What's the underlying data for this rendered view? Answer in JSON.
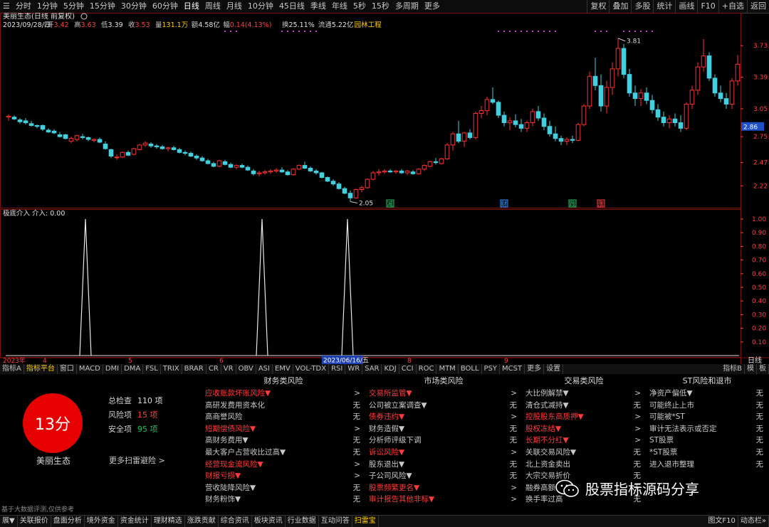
{
  "topbar": {
    "periods": [
      "分时",
      "1分钟",
      "5分钟",
      "15分钟",
      "30分钟",
      "60分钟",
      "日线",
      "周线",
      "月线",
      "10分钟",
      "45日线",
      "季线",
      "年线",
      "5秒",
      "15秒",
      "多周期",
      "更多"
    ],
    "active_period": "日线",
    "right_buttons": [
      "复权",
      "叠加",
      "多股",
      "统计",
      "画线",
      "F10",
      "+自选",
      "返回"
    ]
  },
  "chart_header": {
    "name": "美丽生态(日线 前复权)",
    "date": "2023/09/28/四",
    "items": [
      {
        "label": "开",
        "value": "3.42",
        "color": "#ff4040"
      },
      {
        "label": "高",
        "value": "3.63",
        "color": "#ff4040"
      },
      {
        "label": "低",
        "value": "3.39",
        "color": "#e0e0e0"
      },
      {
        "label": "收",
        "value": "3.53",
        "color": "#ff4040"
      },
      {
        "label": "量",
        "value": "131.1万",
        "color": "#ffcc00"
      },
      {
        "label": "额",
        "value": "4.58亿",
        "color": "#e0e0e0"
      },
      {
        "label": "幅",
        "value": "0.14(4.13%)",
        "color": "#ff4040"
      },
      {
        "label": "换",
        "value": "25.11%",
        "color": "#e0e0e0"
      },
      {
        "label": "流通",
        "value": "5.22亿",
        "color": "#e0e0e0"
      },
      {
        "label": "",
        "value": "园林工程",
        "color": "#ffcc00"
      }
    ]
  },
  "price_axis": [
    "3.73",
    "3.39",
    "3.05",
    "2.75",
    "2.47",
    "2.22"
  ],
  "current_price": "2.86",
  "high_annotation": "3.81",
  "low_annotation": "2.05",
  "events": [
    {
      "label": "减",
      "index": 67,
      "color": "#20c060"
    },
    {
      "label": "财",
      "index": 87,
      "color": "#3090ff"
    },
    {
      "label": "践",
      "index": 99,
      "color": "#20c060"
    },
    {
      "label": "涨",
      "index": 104,
      "color": "#ff4040"
    }
  ],
  "indicator": {
    "title": "极底介入  介入: 0.00",
    "axis": [
      "1.00",
      "0.90",
      "0.80",
      "0.70",
      "0.60",
      "0.50",
      "0.40",
      "0.30",
      "0.20",
      "0.10"
    ]
  },
  "date_axis": {
    "labels": [
      {
        "text": "2023年",
        "index": 0
      },
      {
        "text": "4",
        "index": 6
      },
      {
        "text": "5",
        "index": 21
      },
      {
        "text": "6",
        "index": 37
      },
      {
        "text": "8",
        "index": 70
      },
      {
        "text": "9",
        "index": 87
      }
    ],
    "cursor": "2023/06/16/五",
    "right_label": "日线"
  },
  "chart_data": {
    "type": "candlestick",
    "ohlc": [
      [
        2.96,
        2.99,
        2.92,
        2.97
      ],
      [
        2.96,
        2.98,
        2.93,
        2.94
      ],
      [
        2.93,
        2.95,
        2.89,
        2.91
      ],
      [
        2.92,
        2.95,
        2.88,
        2.9
      ],
      [
        2.89,
        2.92,
        2.86,
        2.87
      ],
      [
        2.87,
        2.88,
        2.84,
        2.86
      ],
      [
        2.87,
        2.88,
        2.81,
        2.83
      ],
      [
        2.82,
        2.84,
        2.79,
        2.8
      ],
      [
        2.81,
        2.83,
        2.78,
        2.79
      ],
      [
        2.77,
        2.8,
        2.74,
        2.75
      ],
      [
        2.77,
        2.78,
        2.72,
        2.73
      ],
      [
        2.7,
        2.75,
        2.68,
        2.73
      ],
      [
        2.72,
        2.77,
        2.7,
        2.76
      ],
      [
        2.75,
        2.78,
        2.72,
        2.74
      ],
      [
        2.74,
        2.75,
        2.7,
        2.72
      ],
      [
        2.71,
        2.73,
        2.69,
        2.72
      ],
      [
        2.72,
        2.74,
        2.68,
        2.69
      ],
      [
        2.67,
        2.7,
        2.61,
        2.62
      ],
      [
        2.61,
        2.62,
        2.52,
        2.54
      ],
      [
        2.53,
        2.56,
        2.5,
        2.53
      ],
      [
        2.53,
        2.59,
        2.52,
        2.58
      ],
      [
        2.58,
        2.6,
        2.54,
        2.55
      ],
      [
        2.56,
        2.63,
        2.55,
        2.62
      ],
      [
        2.61,
        2.67,
        2.6,
        2.66
      ],
      [
        2.66,
        2.7,
        2.64,
        2.68
      ],
      [
        2.67,
        2.69,
        2.63,
        2.65
      ],
      [
        2.65,
        2.67,
        2.62,
        2.64
      ],
      [
        2.64,
        2.66,
        2.61,
        2.62
      ],
      [
        2.62,
        2.64,
        2.59,
        2.63
      ],
      [
        2.63,
        2.65,
        2.6,
        2.61
      ],
      [
        2.61,
        2.63,
        2.57,
        2.58
      ],
      [
        2.58,
        2.6,
        2.55,
        2.57
      ],
      [
        2.57,
        2.59,
        2.53,
        2.54
      ],
      [
        2.54,
        2.56,
        2.5,
        2.52
      ],
      [
        2.52,
        2.54,
        2.48,
        2.49
      ],
      [
        2.49,
        2.51,
        2.45,
        2.46
      ],
      [
        2.46,
        2.48,
        2.42,
        2.43
      ],
      [
        2.43,
        2.5,
        2.42,
        2.49
      ],
      [
        2.48,
        2.5,
        2.44,
        2.45
      ],
      [
        2.45,
        2.47,
        2.41,
        2.42
      ],
      [
        2.42,
        2.45,
        2.4,
        2.44
      ],
      [
        2.44,
        2.46,
        2.41,
        2.42
      ],
      [
        2.42,
        2.44,
        2.38,
        2.39
      ],
      [
        2.38,
        2.4,
        2.33,
        2.35
      ],
      [
        2.35,
        2.38,
        2.32,
        2.36
      ],
      [
        2.36,
        2.39,
        2.34,
        2.37
      ],
      [
        2.37,
        2.4,
        2.35,
        2.38
      ],
      [
        2.38,
        2.41,
        2.36,
        2.39
      ],
      [
        2.39,
        2.42,
        2.36,
        2.37
      ],
      [
        2.37,
        2.39,
        2.33,
        2.34
      ],
      [
        2.34,
        2.41,
        2.33,
        2.4
      ],
      [
        2.4,
        2.45,
        2.39,
        2.44
      ],
      [
        2.44,
        2.48,
        2.4,
        2.41
      ],
      [
        2.41,
        2.43,
        2.37,
        2.38
      ],
      [
        2.38,
        2.4,
        2.34,
        2.36
      ],
      [
        2.36,
        2.37,
        2.3,
        2.31
      ],
      [
        2.31,
        2.32,
        2.26,
        2.27
      ],
      [
        2.27,
        2.29,
        2.22,
        2.24
      ],
      [
        2.24,
        2.26,
        2.18,
        2.19
      ],
      [
        2.19,
        2.21,
        2.13,
        2.14
      ],
      [
        2.14,
        2.17,
        2.05,
        2.09
      ],
      [
        2.09,
        2.19,
        2.08,
        2.18
      ],
      [
        2.18,
        2.22,
        2.15,
        2.2
      ],
      [
        2.2,
        2.3,
        2.19,
        2.29
      ],
      [
        2.29,
        2.38,
        2.28,
        2.36
      ],
      [
        2.36,
        2.4,
        2.33,
        2.37
      ],
      [
        2.37,
        2.4,
        2.35,
        2.38
      ],
      [
        2.38,
        2.4,
        2.36,
        2.37
      ],
      [
        2.37,
        2.39,
        2.35,
        2.38
      ],
      [
        2.38,
        2.4,
        2.35,
        2.36
      ],
      [
        2.36,
        2.39,
        2.34,
        2.38
      ],
      [
        2.37,
        2.39,
        2.34,
        2.35
      ],
      [
        2.35,
        2.41,
        2.34,
        2.4
      ],
      [
        2.4,
        2.45,
        2.38,
        2.44
      ],
      [
        2.43,
        2.49,
        2.42,
        2.48
      ],
      [
        2.48,
        2.52,
        2.45,
        2.47
      ],
      [
        2.46,
        2.52,
        2.45,
        2.51
      ],
      [
        2.51,
        2.68,
        2.5,
        2.66
      ],
      [
        2.66,
        2.8,
        2.6,
        2.78
      ],
      [
        2.78,
        2.92,
        2.68,
        2.7
      ],
      [
        2.7,
        2.8,
        2.64,
        2.79
      ],
      [
        2.79,
        2.83,
        2.72,
        2.74
      ],
      [
        2.74,
        3.02,
        2.72,
        3.0
      ],
      [
        3.0,
        3.08,
        2.95,
        3.03
      ],
      [
        3.03,
        3.18,
        2.98,
        3.15
      ],
      [
        3.15,
        3.28,
        3.1,
        3.12
      ],
      [
        3.12,
        3.14,
        2.95,
        2.98
      ],
      [
        2.98,
        3.02,
        2.86,
        2.9
      ],
      [
        2.9,
        2.96,
        2.82,
        2.92
      ],
      [
        2.92,
        2.99,
        2.85,
        2.88
      ],
      [
        2.88,
        2.94,
        2.8,
        2.84
      ],
      [
        2.84,
        2.92,
        2.8,
        2.9
      ],
      [
        2.9,
        3.05,
        2.86,
        3.02
      ],
      [
        3.02,
        3.08,
        2.92,
        2.95
      ],
      [
        2.95,
        3.0,
        2.82,
        2.86
      ],
      [
        2.86,
        2.92,
        2.75,
        2.78
      ],
      [
        2.78,
        2.86,
        2.7,
        2.73
      ],
      [
        2.73,
        2.76,
        2.66,
        2.7
      ],
      [
        2.7,
        2.74,
        2.66,
        2.72
      ],
      [
        2.72,
        2.76,
        2.68,
        2.71
      ],
      [
        2.71,
        2.9,
        2.7,
        2.88
      ],
      [
        2.88,
        3.1,
        2.86,
        3.08
      ],
      [
        3.08,
        3.45,
        3.05,
        3.4
      ],
      [
        3.4,
        3.6,
        3.25,
        3.3
      ],
      [
        3.3,
        3.42,
        3.02,
        3.08
      ],
      [
        3.08,
        3.35,
        3.0,
        3.28
      ],
      [
        3.28,
        3.55,
        3.2,
        3.48
      ],
      [
        3.48,
        3.81,
        3.4,
        3.7
      ],
      [
        3.7,
        3.75,
        3.38,
        3.42
      ],
      [
        3.42,
        3.48,
        3.18,
        3.22
      ],
      [
        3.22,
        3.3,
        3.08,
        3.16
      ],
      [
        3.16,
        3.26,
        3.08,
        3.22
      ],
      [
        3.22,
        3.28,
        3.1,
        3.14
      ],
      [
        3.14,
        3.2,
        3.0,
        3.04
      ],
      [
        3.04,
        3.1,
        2.92,
        2.96
      ],
      [
        2.96,
        3.02,
        2.86,
        2.9
      ],
      [
        2.9,
        2.98,
        2.84,
        2.94
      ],
      [
        2.94,
        3.0,
        2.86,
        2.9
      ],
      [
        2.9,
        2.98,
        2.8,
        2.84
      ],
      [
        2.84,
        3.12,
        2.82,
        3.1
      ],
      [
        3.1,
        3.3,
        3.05,
        3.25
      ],
      [
        3.25,
        3.55,
        3.2,
        3.5
      ],
      [
        3.5,
        3.8,
        3.45,
        3.62
      ],
      [
        3.62,
        3.66,
        3.35,
        3.38
      ],
      [
        3.38,
        3.42,
        3.18,
        3.22
      ],
      [
        3.22,
        3.3,
        3.12,
        3.16
      ],
      [
        3.16,
        3.22,
        3.05,
        3.1
      ],
      [
        3.1,
        3.38,
        3.05,
        3.35
      ],
      [
        3.35,
        3.63,
        3.3,
        3.53
      ]
    ],
    "indicator_spikes": [
      14,
      45,
      60
    ],
    "indicator_range": [
      0,
      1
    ],
    "price_range": [
      2.0,
      3.9
    ]
  },
  "bottom_tabs": [
    "指标A",
    "指标平台",
    "窗口",
    "MACD",
    "DMI",
    "DMA",
    "FSL",
    "TRIX",
    "BRAR",
    "CR",
    "VR",
    "OBV",
    "ASI",
    "EMV",
    "VOL-TDX",
    "RSI",
    "WR",
    "SAR",
    "KDJ",
    "CCI",
    "ROC",
    "MTM",
    "BOLL",
    "PSY",
    "MCST",
    "更多",
    "设置"
  ],
  "bottom_tabs_right": [
    "指标B",
    "模",
    "板"
  ],
  "risk": {
    "score": "13分",
    "stock_name": "美丽生态",
    "stats": [
      {
        "label": "总检查",
        "value": "110 项",
        "color": "#dddddd"
      },
      {
        "label": "风险项",
        "value": "15 项",
        "color": "#ff4040"
      },
      {
        "label": "安全项",
        "value": "95 项",
        "color": "#20c060"
      }
    ],
    "more": "更多扫雷避险 >",
    "note": "基于大数据评测,仅供参考",
    "columns": [
      {
        "title": "财务类风险",
        "items": [
          {
            "name": "应收账款坏账风险▼",
            "status": ">",
            "risk": true
          },
          {
            "name": "高研发费用资本化",
            "status": "无",
            "risk": false
          },
          {
            "name": "高商誉风险",
            "status": "无",
            "risk": false
          },
          {
            "name": "短期偿债风险▼",
            "status": ">",
            "risk": true
          },
          {
            "name": "高财务费用▼",
            "status": "无",
            "risk": false
          },
          {
            "name": "最大客户占营收比过高▼",
            "status": "无",
            "risk": false
          },
          {
            "name": "经营现金流风险▼",
            "status": ">",
            "risk": true
          },
          {
            "name": "财报亏损▼",
            "status": ">",
            "risk": true
          },
          {
            "name": "营收陡降风险▼",
            "status": "无",
            "risk": false
          },
          {
            "name": "财务粉饰▼",
            "status": "无",
            "risk": false
          }
        ]
      },
      {
        "title": "市场类风险",
        "items": [
          {
            "name": "交易所监管▼",
            "status": ">",
            "risk": true
          },
          {
            "name": "公司被立案调查▼",
            "status": "无",
            "risk": false
          },
          {
            "name": "债券违约▼",
            "status": ">",
            "risk": true
          },
          {
            "name": "财务造假▼",
            "status": "无",
            "risk": false
          },
          {
            "name": "分析师评级下调",
            "status": "无",
            "risk": false
          },
          {
            "name": "诉讼风险▼",
            "status": ">",
            "risk": true
          },
          {
            "name": "股东退出▼",
            "status": "无",
            "risk": false
          },
          {
            "name": "子公司风险▼",
            "status": "无",
            "risk": false
          },
          {
            "name": "股票频繁更名▼",
            "status": ">",
            "risk": true
          },
          {
            "name": "审计报告其他非标▼",
            "status": ">",
            "risk": true
          }
        ]
      },
      {
        "title": "交易类风险",
        "items": [
          {
            "name": "大比例解禁▼",
            "status": ">",
            "risk": false
          },
          {
            "name": "清仓式减持▼",
            "status": "无",
            "risk": false
          },
          {
            "name": "控股股东高质押▼",
            "status": ">",
            "risk": true
          },
          {
            "name": "股权冻结▼",
            "status": ">",
            "risk": true
          },
          {
            "name": "长期不分红▼",
            "status": ">",
            "risk": true
          },
          {
            "name": "关联交易风险▼",
            "status": "无",
            "risk": false
          },
          {
            "name": "北上资金卖出",
            "status": "无",
            "risk": false
          },
          {
            "name": "大宗交易折价",
            "status": "无",
            "risk": false
          },
          {
            "name": "融券高额",
            "status": "无",
            "risk": false
          },
          {
            "name": "换手率过高",
            "status": "无",
            "risk": false
          }
        ]
      },
      {
        "title": "ST风险和退市",
        "items": [
          {
            "name": "净资产偏低▼",
            "status": "无",
            "risk": false
          },
          {
            "name": "可能终止上市",
            "status": "无",
            "risk": false
          },
          {
            "name": "可能被*ST",
            "status": "无",
            "risk": false
          },
          {
            "name": "审计无法表示或否定",
            "status": "无",
            "risk": false
          },
          {
            "name": "ST股票",
            "status": "无",
            "risk": false
          },
          {
            "name": "*ST股票",
            "status": "无",
            "risk": false
          },
          {
            "name": "进入退市整理",
            "status": "无",
            "risk": false
          }
        ]
      }
    ]
  },
  "status_bar": [
    "展▼",
    "关联报价",
    "盘面分析",
    "境外资金",
    "资金统计",
    "理财精选",
    "涨跌贡献",
    "综合资讯",
    "板块资讯",
    "行业数据",
    "互动问答",
    "扫雷宝"
  ],
  "status_active": "扫雷宝",
  "status_right": [
    "图文F10",
    "动态栏»"
  ],
  "watermark": "股票指标源码分享"
}
